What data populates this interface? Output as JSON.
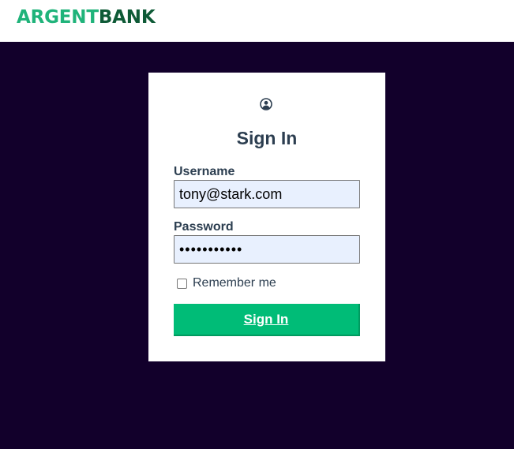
{
  "header": {
    "logo_part1": "ARGENT",
    "logo_part2": "BANK"
  },
  "signin": {
    "icon": "user-circle-icon",
    "title": "Sign In",
    "username_label": "Username",
    "username_value": "tony@stark.com",
    "password_label": "Password",
    "password_value": "•••••••••••",
    "remember_label": "Remember me",
    "remember_checked": false,
    "button_label": "Sign In"
  },
  "colors": {
    "background": "#12002b",
    "brand_light": "#1fb37a",
    "brand_dark": "#0e5a36",
    "button": "#00bc77",
    "text": "#2c3e50"
  }
}
